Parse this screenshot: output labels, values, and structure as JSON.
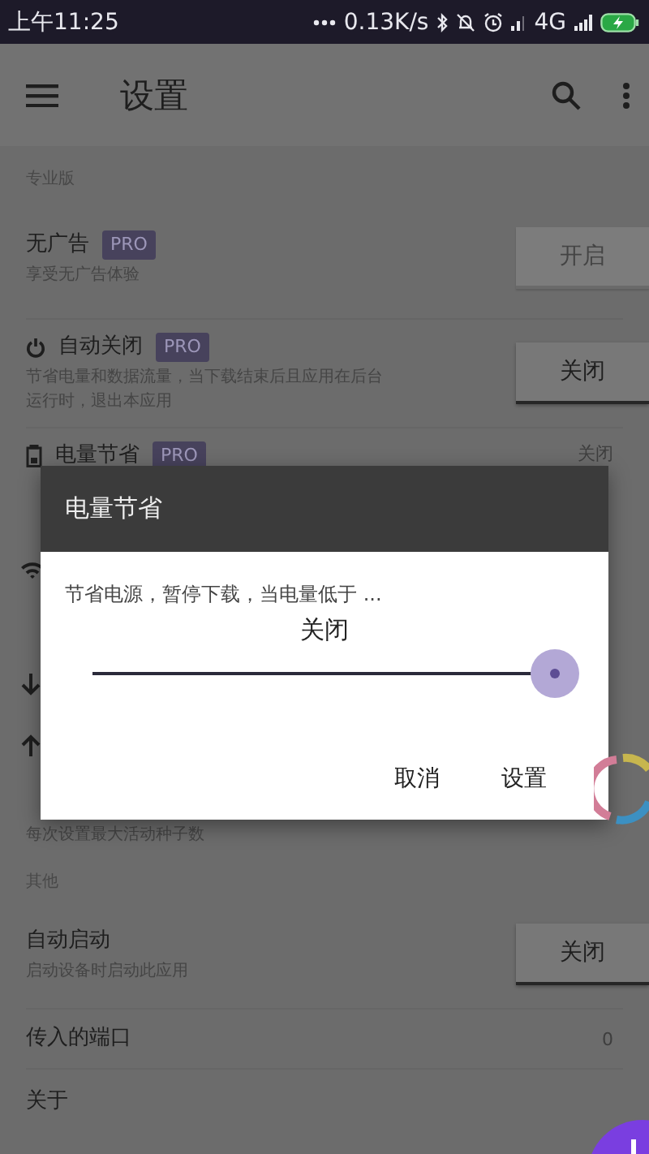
{
  "status_bar": {
    "time": "上午11:25",
    "net_speed": "0.13K/s",
    "network": "4G"
  },
  "app_bar": {
    "title": "设置"
  },
  "settings": [
    {
      "kind": "header",
      "title": "专业版"
    },
    {
      "kind": "button",
      "title": "无广告",
      "badge": "PRO",
      "subtitle": "享受无广告体验",
      "button": {
        "label": "开启",
        "disabled": true
      }
    },
    {
      "kind": "button",
      "title": "自动关闭",
      "badge": "PRO",
      "subtitle": "节省电量和数据流量，当下载结束后且应用在后台运行时，退出本应用",
      "button": {
        "label": "关闭",
        "disabled": false
      }
    },
    {
      "kind": "value",
      "title": "电量节省",
      "badge": "PRO",
      "value": "关闭"
    },
    {
      "kind": "covered"
    },
    {
      "kind": "note",
      "subtitle": "每次设置最大活动种子数"
    },
    {
      "kind": "header",
      "title": "其他"
    },
    {
      "kind": "button",
      "title": "自动启动",
      "subtitle": "启动设备时启动此应用",
      "button": {
        "label": "关闭",
        "disabled": false
      }
    },
    {
      "kind": "value",
      "title": "传入的端口",
      "value": "0"
    },
    {
      "kind": "link",
      "title": "关于"
    }
  ],
  "dialog": {
    "title": "电量节省",
    "message": "节省电源，暂停下载，当电量低于 ...",
    "value_label": "关闭",
    "slider": {
      "level": 1.0
    },
    "buttons": [
      "取消",
      "设置"
    ]
  }
}
